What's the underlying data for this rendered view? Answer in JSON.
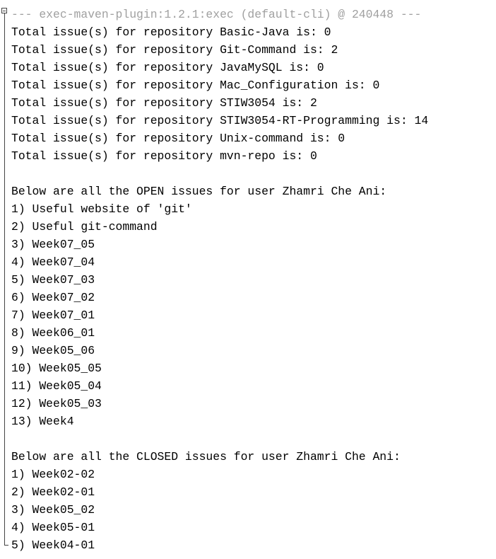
{
  "console": {
    "header": "--- exec-maven-plugin:1.2.1:exec (default-cli) @ 240448 ---",
    "lines": [
      "Total issue(s) for repository Basic-Java is: 0",
      "Total issue(s) for repository Git-Command is: 2",
      "Total issue(s) for repository JavaMySQL is: 0",
      "Total issue(s) for repository Mac_Configuration is: 0",
      "Total issue(s) for repository STIW3054 is: 2",
      "Total issue(s) for repository STIW3054-RT-Programming is: 14",
      "Total issue(s) for repository Unix-command is: 0",
      "Total issue(s) for repository mvn-repo is: 0",
      "",
      "Below are all the OPEN issues for user Zhamri Che Ani:",
      "1) Useful website of 'git'",
      "2) Useful git-command",
      "3) Week07_05",
      "4) Week07_04",
      "5) Week07_03",
      "6) Week07_02",
      "7) Week07_01",
      "8) Week06_01",
      "9) Week05_06",
      "10) Week05_05",
      "11) Week05_04",
      "12) Week05_03",
      "13) Week4",
      "",
      "Below are all the CLOSED issues for user Zhamri Che Ani:",
      "1) Week02-02",
      "2) Week02-01",
      "3) Week05_02",
      "4) Week05-01",
      "5) Week04-01"
    ]
  }
}
